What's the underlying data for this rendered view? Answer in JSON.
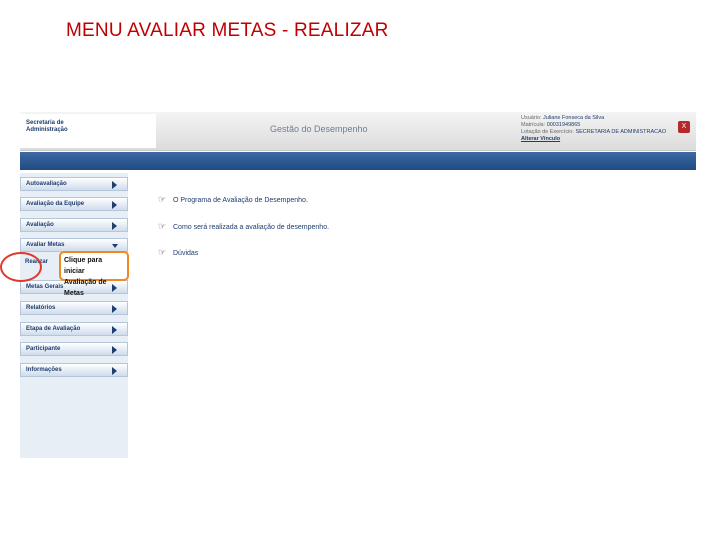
{
  "slide": {
    "title": "MENU AVALIAR  METAS - REALIZAR"
  },
  "header": {
    "org_name": "Secretaria de Administração",
    "system_title": "Gestão do Desempenho",
    "user": {
      "name_label": "Usuário:",
      "name": "Juliane Fonseca da Silva",
      "registration_label": "Matrícula:",
      "registration": "00031949865",
      "unit_label": "Lotação de Exercício:",
      "unit": "SECRETARIA DE ADMINISTRACAO",
      "change_link": "Alterar Vínculo"
    },
    "close_label": "X"
  },
  "menu": {
    "items": [
      {
        "label": "Autoavaliação"
      },
      {
        "label": "Avaliação da Equipe"
      },
      {
        "label": "Avaliação"
      },
      {
        "label": "Avaliar Metas"
      },
      {
        "label": "Metas Gerais"
      },
      {
        "label": "Relatórios"
      },
      {
        "label": "Etapa de Avaliação"
      },
      {
        "label": "Participante"
      },
      {
        "label": "Informações"
      }
    ],
    "submenu": {
      "label": "Realizar"
    },
    "callout": {
      "line1": "Clique para iniciar",
      "line2": "Avaliação de Metas"
    }
  },
  "content": {
    "links": [
      {
        "icon": "pointing-hand-icon",
        "label": "O Programa de Avaliação de Desempenho."
      },
      {
        "icon": "pointing-hand-icon",
        "label": "Como será realizada a avaliação de desempenho."
      },
      {
        "icon": "pointing-hand-icon",
        "label": "Dúvidas"
      }
    ]
  },
  "colors": {
    "title": "#c00000",
    "header_bar": "#2a5791",
    "highlight": "#e0382c",
    "callout_border": "#f08a1c"
  }
}
